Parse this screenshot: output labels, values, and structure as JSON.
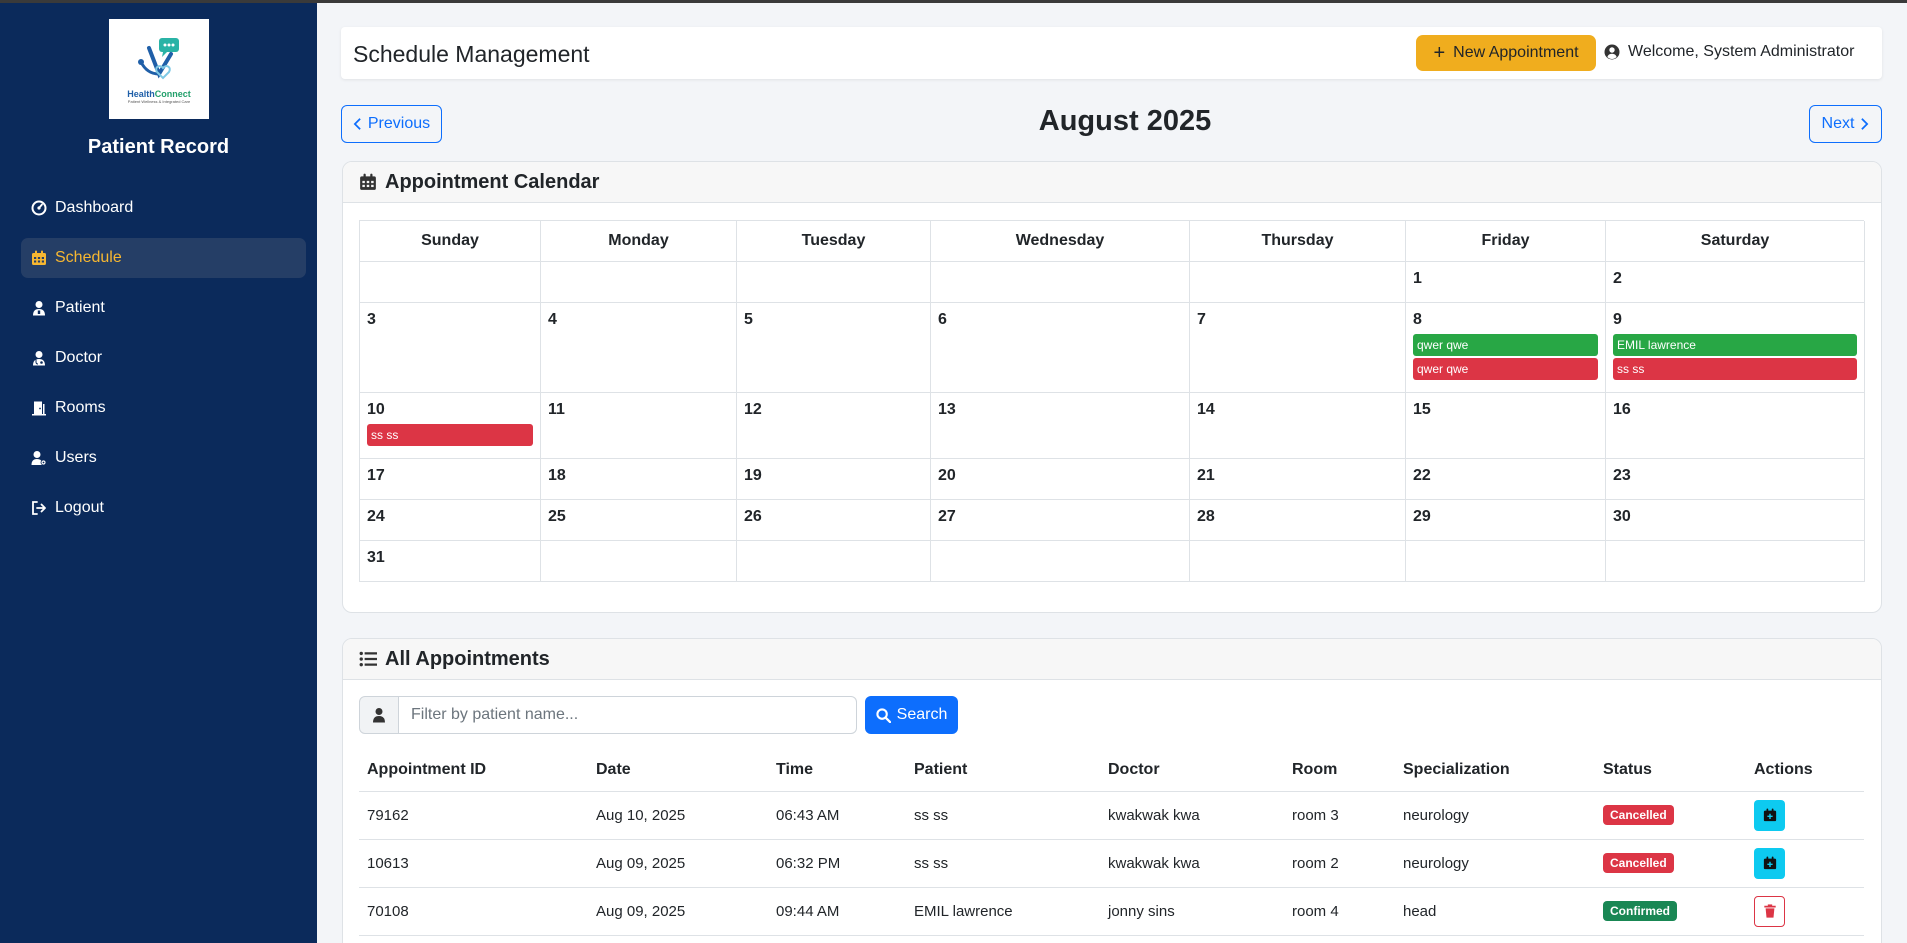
{
  "sidebar": {
    "logo": {
      "name_part1": "Health",
      "name_part2": "Connect",
      "tagline": "Patient Wellness & Integrated Care"
    },
    "brand": "Patient Record",
    "items": [
      {
        "label": "Dashboard",
        "icon": "dashboard-icon"
      },
      {
        "label": "Schedule",
        "icon": "calendar-icon",
        "active": true
      },
      {
        "label": "Patient",
        "icon": "patient-icon"
      },
      {
        "label": "Doctor",
        "icon": "doctor-icon"
      },
      {
        "label": "Rooms",
        "icon": "door-icon"
      },
      {
        "label": "Users",
        "icon": "users-icon"
      },
      {
        "label": "Logout",
        "icon": "logout-icon"
      }
    ]
  },
  "header": {
    "title": "Schedule Management",
    "new_button": "New Appointment",
    "welcome": "Welcome, System Administrator"
  },
  "month_nav": {
    "previous": "Previous",
    "next": "Next",
    "month": "August 2025"
  },
  "calendar": {
    "title": "Appointment Calendar",
    "weekdays": [
      "Sunday",
      "Monday",
      "Tuesday",
      "Wednesday",
      "Thursday",
      "Friday",
      "Saturday"
    ],
    "events": {
      "8": [
        {
          "label": "qwer qwe",
          "status": "green"
        },
        {
          "label": "qwer qwe",
          "status": "red"
        }
      ],
      "9": [
        {
          "label": "EMIL lawrence",
          "status": "green"
        },
        {
          "label": "ss ss",
          "status": "red"
        }
      ],
      "10": [
        {
          "label": "ss ss",
          "status": "red"
        }
      ]
    }
  },
  "appointments": {
    "title": "All Appointments",
    "filter_placeholder": "Filter by patient name...",
    "search_button": "Search",
    "columns": [
      "Appointment ID",
      "Date",
      "Time",
      "Patient",
      "Doctor",
      "Room",
      "Specialization",
      "Status",
      "Actions"
    ],
    "rows": [
      {
        "id": "79162",
        "date": "Aug 10, 2025",
        "time": "06:43 AM",
        "patient": "ss ss",
        "doctor": "kwakwak kwa",
        "room": "room 3",
        "specialization": "neurology",
        "status": "Cancelled",
        "action": "reschedule"
      },
      {
        "id": "10613",
        "date": "Aug 09, 2025",
        "time": "06:32 PM",
        "patient": "ss ss",
        "doctor": "kwakwak kwa",
        "room": "room 2",
        "specialization": "neurology",
        "status": "Cancelled",
        "action": "reschedule"
      },
      {
        "id": "70108",
        "date": "Aug 09, 2025",
        "time": "09:44 AM",
        "patient": "EMIL lawrence",
        "doctor": "jonny sins",
        "room": "room 4",
        "specialization": "head",
        "status": "Confirmed",
        "action": "delete"
      }
    ]
  },
  "colors": {
    "sidebar_bg": "#0b2a5b",
    "accent": "#f0ad1e",
    "primary": "#0d6efd",
    "event_green": "#28a745",
    "event_red": "#dc3545",
    "badge_confirmed": "#198754",
    "action_cyan": "#0dcaf0"
  }
}
